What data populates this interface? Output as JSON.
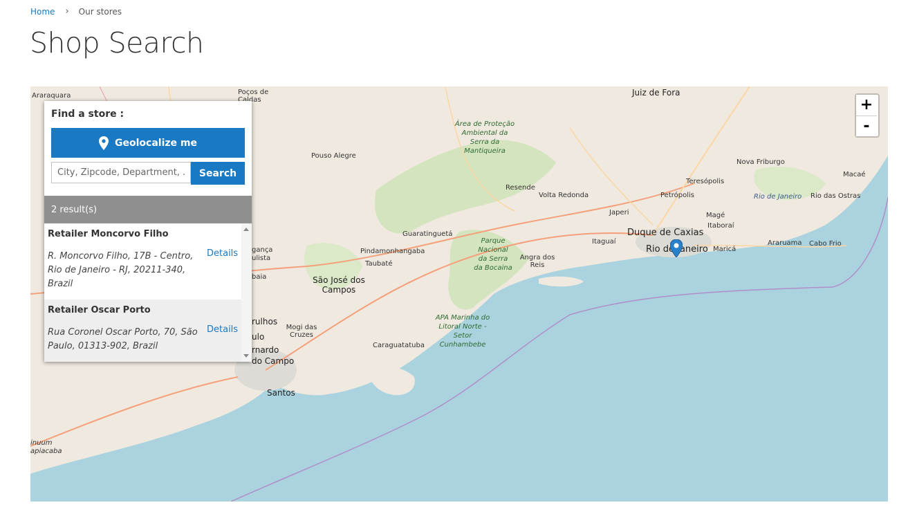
{
  "breadcrumb": {
    "home": "Home",
    "current": "Our stores"
  },
  "page_title": "Shop Search",
  "store_finder": {
    "heading": "Find a store :",
    "geolocate_label": "Geolocalize me",
    "search_placeholder": "City, Zipcode, Department, ...",
    "search_label": "Search",
    "results_count": "2 result(s)",
    "stores": [
      {
        "name": "Retailer Moncorvo Filho",
        "address": "R. Moncorvo Filho, 17B - Centro, Rio de Janeiro - RJ, 20211-340, Brazil",
        "details": "Details"
      },
      {
        "name": "Retailer Oscar Porto",
        "address": "Rua Coronel Oscar Porto, 70, São Paulo, 01313-902, Brazil",
        "details": "Details"
      }
    ]
  },
  "map": {
    "zoom_in": "+",
    "zoom_out": "-",
    "labels": {
      "juiz": "Juiz de Fora",
      "araraquara": "Araraquara",
      "pocos": "Poços de Caldas",
      "pouso": "Pouso Alegre",
      "area_park": "Área de Proteção Ambiental da Serra da Mantiqueira",
      "resende": "Resende",
      "volta": "Volta Redonda",
      "nova": "Nova Friburgo",
      "teresopolis": "Teresópolis",
      "petropolis": "Petrópolis",
      "rio_janeiro_water": "Rio de Janeiro",
      "rio_ostras": "Rio das Ostras",
      "macae": "Macaé",
      "guaratingueta": "Guaratinguetá",
      "japeri": "Japeri",
      "mage": "Magé",
      "itaborai": "Itaboraí",
      "duque": "Duque de Caxias",
      "rio": "Rio de Janeiro",
      "marica": "Maricá",
      "araruama": "Araruama",
      "cabo": "Cabo Frio",
      "pinda": "Pindamonhangaba",
      "parque": "Parque Nacional da Serra da Bocaina",
      "itaguai": "Itaguaí",
      "angra": "Angra dos Reis",
      "taubate": "Taubaté",
      "sjc": "São José dos Campos",
      "braganca": "gança",
      "atibaia_fr": "ulista",
      "baia": "baia",
      "guarulhos": "rulhos",
      "mogi": "Mogi das Cruzes",
      "apa": "APA Marinha do Litoral Norte - Setor Cunhambebe",
      "caragua": "Caraguatatuba",
      "sulo": "ulo",
      "bernardo": "rnardo",
      "campo": "do Campo",
      "santos": "Santos",
      "inuum": "inuum",
      "piacaba": "apiacaba"
    }
  }
}
